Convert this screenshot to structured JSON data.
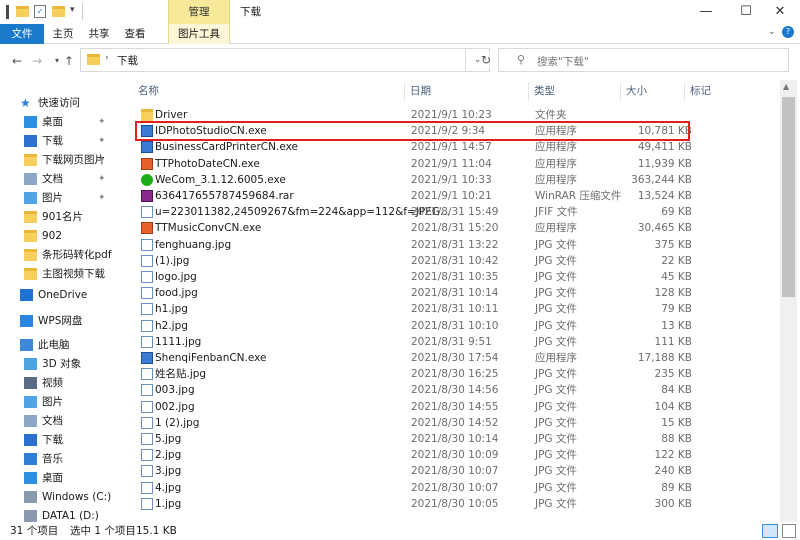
{
  "titlebar": {
    "context_tab": "管理",
    "window_title": "下载",
    "minimize": "—",
    "maximize": "☐",
    "close": "✕"
  },
  "ribbon": {
    "tabs": [
      "文件",
      "主页",
      "共享",
      "查看",
      "图片工具"
    ]
  },
  "address": {
    "path": "下载",
    "search_placeholder": "搜索\"下载\""
  },
  "sidebar": {
    "items": [
      {
        "label": "快速访问",
        "icon": "star-icon",
        "pinned": false
      },
      {
        "label": "桌面",
        "icon": "desktop-icon",
        "pinned": true
      },
      {
        "label": "下载",
        "icon": "download-icon",
        "pinned": true
      },
      {
        "label": "下载网页图片",
        "icon": "folder-icon",
        "pinned": true
      },
      {
        "label": "文档",
        "icon": "document-icon",
        "pinned": true
      },
      {
        "label": "图片",
        "icon": "picture-icon",
        "pinned": true
      },
      {
        "label": "901名片",
        "icon": "folder-icon",
        "pinned": false
      },
      {
        "label": "902",
        "icon": "folder-icon",
        "pinned": false
      },
      {
        "label": "条形码转化pdf",
        "icon": "folder-icon",
        "pinned": false
      },
      {
        "label": "主图视频下载",
        "icon": "folder-icon",
        "pinned": false
      },
      {
        "label": "OneDrive",
        "icon": "cloud-icon",
        "pinned": false
      },
      {
        "label": "WPS网盘",
        "icon": "wps-cloud-icon",
        "pinned": false
      },
      {
        "label": "此电脑",
        "icon": "computer-icon",
        "pinned": false
      },
      {
        "label": "3D 对象",
        "icon": "cube-icon",
        "pinned": false
      },
      {
        "label": "视频",
        "icon": "video-icon",
        "pinned": false
      },
      {
        "label": "图片",
        "icon": "picture-icon",
        "pinned": false
      },
      {
        "label": "文档",
        "icon": "document-icon",
        "pinned": false
      },
      {
        "label": "下载",
        "icon": "download-icon",
        "pinned": false
      },
      {
        "label": "音乐",
        "icon": "music-icon",
        "pinned": false
      },
      {
        "label": "桌面",
        "icon": "desktop-icon",
        "pinned": false
      },
      {
        "label": "Windows (C:)",
        "icon": "drive-icon",
        "pinned": false
      },
      {
        "label": "DATA1 (D:)",
        "icon": "drive-icon",
        "pinned": false
      }
    ]
  },
  "columns": {
    "name": "名称",
    "date": "日期",
    "type": "类型",
    "size": "大小",
    "tag": "标记"
  },
  "files": [
    {
      "name": "Driver",
      "date": "2021/9/1 10:23",
      "type": "文件夹",
      "size": "",
      "icon": "folder"
    },
    {
      "name": "IDPhotoStudioCN.exe",
      "date": "2021/9/2 9:34",
      "type": "应用程序",
      "size": "10,781 KB",
      "icon": "exe"
    },
    {
      "name": "BusinessCardPrinterCN.exe",
      "date": "2021/9/1 14:57",
      "type": "应用程序",
      "size": "49,411 KB",
      "icon": "exe"
    },
    {
      "name": "TTPhotoDateCN.exe",
      "date": "2021/9/1 11:04",
      "type": "应用程序",
      "size": "11,939 KB",
      "icon": "exe2"
    },
    {
      "name": "WeCom_3.1.12.6005.exe",
      "date": "2021/9/1 10:33",
      "type": "应用程序",
      "size": "363,244 KB",
      "icon": "wecom"
    },
    {
      "name": "636417655787459684.rar",
      "date": "2021/9/1 10:21",
      "type": "WinRAR 压缩文件",
      "size": "13,524 KB",
      "icon": "rar"
    },
    {
      "name": "u=223011382,24509267&fm=224&app=112&f=JPEG...",
      "date": "2021/8/31 15:49",
      "type": "JFIF 文件",
      "size": "69 KB",
      "icon": "img"
    },
    {
      "name": "TTMusicConvCN.exe",
      "date": "2021/8/31 15:20",
      "type": "应用程序",
      "size": "30,465 KB",
      "icon": "exe2"
    },
    {
      "name": "fenghuang.jpg",
      "date": "2021/8/31 13:22",
      "type": "JPG 文件",
      "size": "375 KB",
      "icon": "img"
    },
    {
      "name": "(1).jpg",
      "date": "2021/8/31 10:42",
      "type": "JPG 文件",
      "size": "22 KB",
      "icon": "img"
    },
    {
      "name": "logo.jpg",
      "date": "2021/8/31 10:35",
      "type": "JPG 文件",
      "size": "45 KB",
      "icon": "img"
    },
    {
      "name": "food.jpg",
      "date": "2021/8/31 10:14",
      "type": "JPG 文件",
      "size": "128 KB",
      "icon": "img"
    },
    {
      "name": "h1.jpg",
      "date": "2021/8/31 10:11",
      "type": "JPG 文件",
      "size": "79 KB",
      "icon": "img"
    },
    {
      "name": "h2.jpg",
      "date": "2021/8/31 10:10",
      "type": "JPG 文件",
      "size": "13 KB",
      "icon": "img"
    },
    {
      "name": "1111.jpg",
      "date": "2021/8/31 9:51",
      "type": "JPG 文件",
      "size": "111 KB",
      "icon": "img"
    },
    {
      "name": "ShenqiFenbanCN.exe",
      "date": "2021/8/30 17:54",
      "type": "应用程序",
      "size": "17,188 KB",
      "icon": "exe"
    },
    {
      "name": "姓名贴.jpg",
      "date": "2021/8/30 16:25",
      "type": "JPG 文件",
      "size": "235 KB",
      "icon": "img"
    },
    {
      "name": "003.jpg",
      "date": "2021/8/30 14:56",
      "type": "JPG 文件",
      "size": "84 KB",
      "icon": "img"
    },
    {
      "name": "002.jpg",
      "date": "2021/8/30 14:55",
      "type": "JPG 文件",
      "size": "104 KB",
      "icon": "img"
    },
    {
      "name": "1 (2).jpg",
      "date": "2021/8/30 14:52",
      "type": "JPG 文件",
      "size": "15 KB",
      "icon": "img"
    },
    {
      "name": "5.jpg",
      "date": "2021/8/30 10:14",
      "type": "JPG 文件",
      "size": "88 KB",
      "icon": "img"
    },
    {
      "name": "2.jpg",
      "date": "2021/8/30 10:09",
      "type": "JPG 文件",
      "size": "122 KB",
      "icon": "img"
    },
    {
      "name": "3.jpg",
      "date": "2021/8/30 10:07",
      "type": "JPG 文件",
      "size": "240 KB",
      "icon": "img"
    },
    {
      "name": "4.jpg",
      "date": "2021/8/30 10:07",
      "type": "JPG 文件",
      "size": "89 KB",
      "icon": "img"
    },
    {
      "name": "1.jpg",
      "date": "2021/8/30 10:05",
      "type": "JPG 文件",
      "size": "300 KB",
      "icon": "img"
    }
  ],
  "selected_file": "IDPhotoStudioCN.exe",
  "status": {
    "count": "31 个项目",
    "selection": "选中 1 个项目",
    "size": "15.1 KB"
  },
  "colors": {
    "accent": "#1979ca",
    "highlight_border": "#e02020",
    "context_tab": "#f7e99a"
  }
}
